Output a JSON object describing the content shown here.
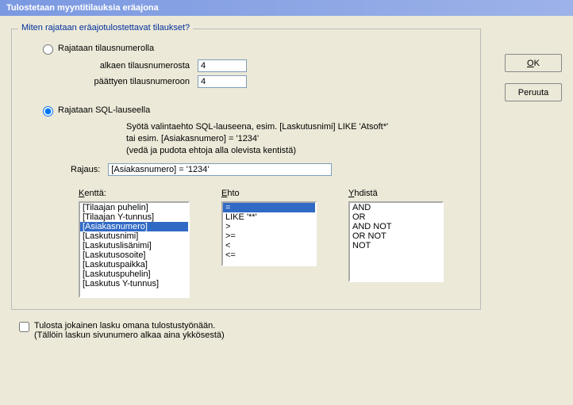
{
  "title": "Tulostetaan myyntitilauksia eräajona",
  "groupbox_title": "Miten rajataan eräajotulostettavat tilaukset?",
  "radio1_label": "Rajataan tilausnumerolla",
  "from_label": "alkaen tilausnumerosta",
  "from_value": "4",
  "to_label": "päättyen tilausnumeroon",
  "to_value": "4",
  "radio2_label": "Rajataan SQL-lauseella",
  "hint_line1": "Syötä valintaehto SQL-lauseena, esim. [Laskutusnimi] LIKE 'Atsoft*'",
  "hint_line2": "tai esim. [Asiakasnumero] = '1234'",
  "hint_line3": "(vedä ja pudota ehtoja alla olevista kentistä)",
  "rajaus_label": "Rajaus:",
  "rajaus_value": "[Asiakasnumero] = '1234'",
  "kentta_label_u": "K",
  "kentta_label_rest": "enttä:",
  "ehto_label_u": "E",
  "ehto_label_rest": "hto",
  "yhdista_label_u": "Y",
  "yhdista_label_rest": "hdistä",
  "kentta_items": [
    "[Tilaajan puhelin]",
    "[Tilaajan Y-tunnus]",
    "[Asiakasnumero]",
    "[Laskutusnimi]",
    "[Laskutuslisänimi]",
    "[Laskutusosoite]",
    "[Laskutuspaikka]",
    "[Laskutuspuhelin]",
    "[Laskutus Y-tunnus]"
  ],
  "ehto_items": [
    "=",
    "LIKE '**'",
    ">",
    ">=",
    "<",
    "<="
  ],
  "yhdista_items": [
    "AND",
    "OR",
    "AND NOT",
    "OR NOT",
    "NOT"
  ],
  "checkbox_line1": "Tulosta jokainen lasku omana tulostustyönään.",
  "checkbox_line2": "(Tällöin laskun sivunumero alkaa aina ykkösestä)",
  "ok_u": "O",
  "ok_rest": "K",
  "cancel_label": "Peruuta"
}
